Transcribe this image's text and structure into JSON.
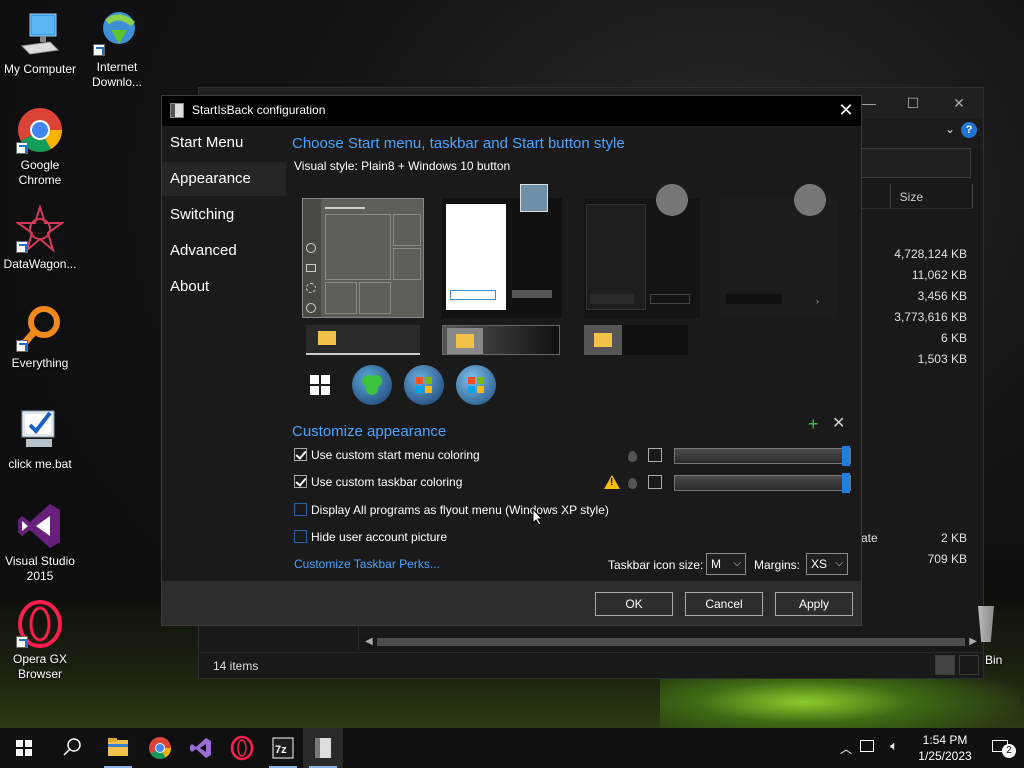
{
  "desktop": {
    "icons": [
      {
        "label": "My Computer"
      },
      {
        "label": "Internet Downlo..."
      },
      {
        "label": "Google Chrome"
      },
      {
        "label": "DataWagon..."
      },
      {
        "label": "Everything"
      },
      {
        "label": "click me.bat"
      },
      {
        "label": "Visual Studio 2015"
      },
      {
        "label": "Opera GX Browser"
      }
    ],
    "recycle_fragment": "Bin"
  },
  "explorer": {
    "column_size": "Size",
    "sizes": [
      "4,728,124 KB",
      "11,062 KB",
      "3,456 KB",
      "3,773,616 KB",
      "6 KB",
      "1,503 KB",
      "2 KB",
      "709 KB"
    ],
    "name_fragment": "ate",
    "status": "14 items"
  },
  "dialog": {
    "title": "StartIsBack configuration",
    "close": "✕",
    "nav": [
      "Start Menu",
      "Appearance",
      "Switching",
      "Advanced",
      "About"
    ],
    "active_nav": "Appearance",
    "style_section_title": "Choose Start menu, taskbar and Start button style",
    "visual_style": "Visual style:  Plain8 + Windows 10 button",
    "customize_title": "Customize appearance",
    "options": [
      {
        "label": "Use custom start menu coloring",
        "checked": true
      },
      {
        "label": "Use custom taskbar coloring",
        "checked": true
      },
      {
        "label": "Display All programs as flyout menu (Windows XP style)",
        "checked": false
      },
      {
        "label": "Hide user account picture",
        "checked": false
      }
    ],
    "perks_link": "Customize Taskbar Perks...",
    "icon_size_label": "Taskbar icon size:",
    "icon_size_value": "M",
    "margins_label": "Margins:",
    "margins_value": "XS",
    "buttons": {
      "ok": "OK",
      "cancel": "Cancel",
      "apply": "Apply"
    }
  },
  "taskbar": {
    "time": "1:54 PM",
    "date": "1/25/2023",
    "notifications": "2"
  },
  "colors": {
    "accent_blue": "#4aa3ff",
    "slider_knob": "#1e7fe0",
    "warning": "#f2c100"
  }
}
